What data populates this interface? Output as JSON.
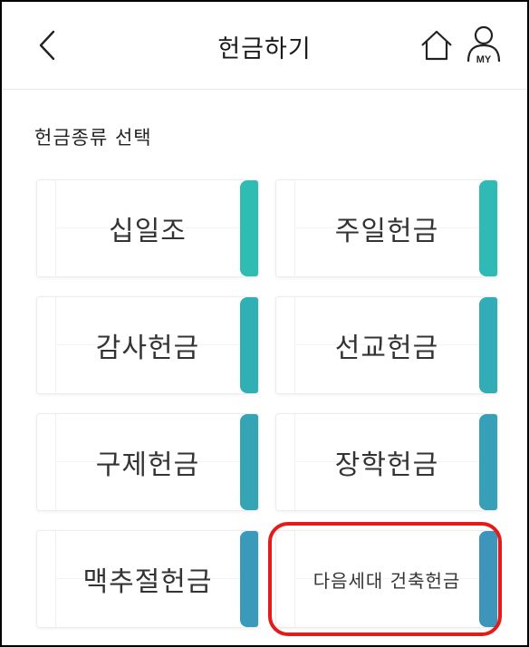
{
  "header": {
    "title": "헌금하기",
    "back_icon": "chevron-left-icon",
    "home_icon": "home-icon",
    "my_icon": "user-my-icon",
    "my_label": "MY"
  },
  "section": {
    "title": "헌금종류 선택"
  },
  "offerings": [
    {
      "label": "십일조",
      "stripe_color": "#2ebcb3"
    },
    {
      "label": "주일헌금",
      "stripe_color": "#2fbab5"
    },
    {
      "label": "감사헌금",
      "stripe_color": "#30b0b4"
    },
    {
      "label": "선교헌금",
      "stripe_color": "#32acb6"
    },
    {
      "label": "구제헌금",
      "stripe_color": "#35a5b6"
    },
    {
      "label": "장학헌금",
      "stripe_color": "#379fb8"
    },
    {
      "label": "맥추절헌금",
      "stripe_color": "#3a9aba"
    },
    {
      "label": "다음세대 건축헌금",
      "stripe_color": "#3d95bc"
    }
  ],
  "colors": {
    "highlight": "#e31b1b"
  }
}
